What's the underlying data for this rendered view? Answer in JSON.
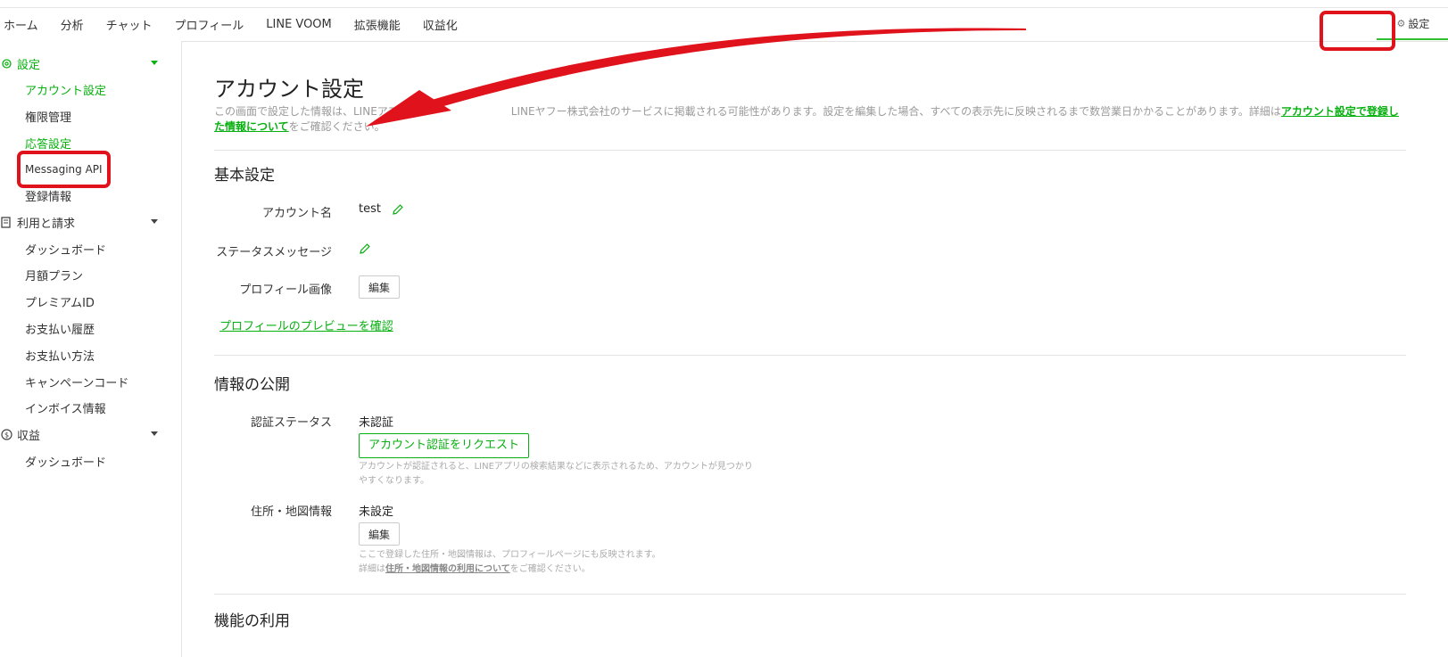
{
  "topnav": {
    "items": [
      "ホーム",
      "分析",
      "チャット",
      "プロフィール",
      "LINE VOOM",
      "拡張機能",
      "収益化"
    ],
    "settings_label": "設定",
    "settings_icon": "gear-icon"
  },
  "sidebar": {
    "settings_section": "設定",
    "settings_items": [
      "アカウント設定",
      "権限管理",
      "応答設定",
      "Messaging API",
      "登録情報"
    ],
    "billing_section": "利用と請求",
    "billing_items": [
      "ダッシュボード",
      "月額プラン",
      "プレミアムID",
      "お支払い履歴",
      "お支払い方法",
      "キャンペーンコード",
      "インボイス情報"
    ],
    "revenue_section": "収益",
    "revenue_items": [
      "ダッシュボード"
    ]
  },
  "main": {
    "title": "アカウント設定",
    "description_part1": "この画面で設定した情報は、LINEアプリ",
    "description_part2": "LINEヤフー株式会社のサービスに掲載される可能性があります。設定を編集した場合、すべての表示先に反映されるまで数営業日かかることがあります。詳細は",
    "description_link": "アカウント設定で登録した情報について",
    "description_suffix": "をご確認ください。",
    "basic": {
      "heading": "基本設定",
      "account_name_label": "アカウント名",
      "account_name_value": "test",
      "status_message_label": "ステータスメッセージ",
      "profile_image_label": "プロフィール画像",
      "edit_button": "編集",
      "preview_link": "プロフィールのプレビューを確認"
    },
    "publicity": {
      "heading": "情報の公開",
      "verification_label": "認証ステータス",
      "verification_value": "未認証",
      "request_button": "アカウント認証をリクエスト",
      "verification_note": "アカウントが認証されると、LINEアプリの検索結果などに表示されるため、アカウントが見つかりやすくなります。",
      "address_label": "住所・地図情報",
      "address_value": "未設定",
      "edit_button": "編集",
      "address_note_line1": "ここで登録した住所・地図情報は、プロフィールページにも反映されます。",
      "address_note_prefix": "詳細は",
      "address_note_link": "住所・地図情報の利用について",
      "address_note_suffix": "をご確認ください。"
    },
    "features": {
      "heading": "機能の利用"
    }
  },
  "colors": {
    "accent": "#06b00e",
    "annotation": "#e0121b"
  }
}
